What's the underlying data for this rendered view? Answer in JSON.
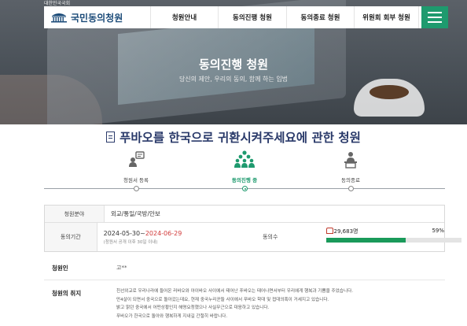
{
  "header": {
    "gov_label": "대한민국국회",
    "utility_links": "",
    "logo_text": "국민동의청원",
    "nav": [
      "청원안내",
      "동의진행 청원",
      "동의종료 청원",
      "위원회 회부 청원"
    ]
  },
  "hero": {
    "title": "동의진행 청원",
    "subtitle": "당신의 제안, 우리의 동의, 함께 하는 입법"
  },
  "petition": {
    "title": "푸바오를 한국으로 귀환시켜주세요에 관한 청원"
  },
  "steps": [
    {
      "label": "청원서 등록",
      "icon": "register-icon",
      "active": false
    },
    {
      "label": "동의진행 중",
      "icon": "people-group-icon",
      "active": true
    },
    {
      "label": "동의종료",
      "icon": "person-podium-icon",
      "active": false
    }
  ],
  "info": {
    "field_label": "청원분야",
    "field_value": "외교/통일/국방/안보",
    "period_label": "동의기간",
    "period_start": "2024-05-30~",
    "period_end": "2024-06-29",
    "period_note": "(청원서 공개 이후 30일 이내)",
    "votes_label": "동의수",
    "votes_count": "29,683명",
    "votes_percent": "59%",
    "votes_ratio": 0.59
  },
  "details": {
    "petitioner_label": "청원인",
    "petitioner_value": "고**",
    "purpose_label": "청원의 취지",
    "purpose_lines": [
      "친선외교로 우리나라에 들어온 러바오와 아이바오 사이에서 태어난 푸바오는 태어나면서부터 우리에게 행복과 기쁨을 주었습니다.",
      "만4살이 되면서 중국으로 돌아갔는데요, 현재 중국누리꾼들 사이에서 푸바오 학대 및 접대의혹이 거세지고 있습니다.",
      "밝고 맑던 중국에서 어떤상황인지 해명요청했으나 사실무근으로 대응하고 있습니다.",
      "푸바오가 한국으로 돌아와 행복하게 지내길 간절히 바랍니다."
    ]
  },
  "colors": {
    "brand_green": "#1e9a6e",
    "title_navy": "#2a3a6a",
    "end_date_red": "#d23a3a",
    "progress_fill": "#1a9a5a"
  }
}
